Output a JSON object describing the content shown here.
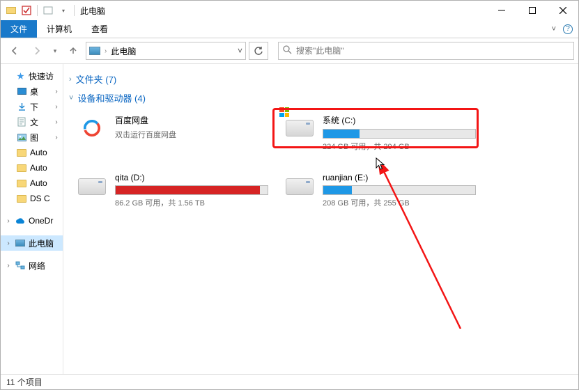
{
  "titlebar": {
    "title": "此电脑"
  },
  "ribbon": {
    "file": "文件",
    "computer": "计算机",
    "view": "查看"
  },
  "address": {
    "text": "此电脑"
  },
  "search": {
    "placeholder": "搜索\"此电脑\""
  },
  "sidebar": {
    "quick": "快速访",
    "items": [
      "桌",
      "下",
      "文",
      "图",
      "Auto",
      "Auto",
      "Auto",
      "DS C"
    ],
    "onedrive": "OneDr",
    "thispc": "此电脑",
    "network": "网络"
  },
  "sections": {
    "folders": {
      "label": "文件夹 (7)"
    },
    "devices": {
      "label": "设备和驱动器 (4)"
    }
  },
  "drives": [
    {
      "kind": "app",
      "name": "百度网盘",
      "sub": "双击运行百度网盘"
    },
    {
      "kind": "os",
      "name": "系统 (C:)",
      "sub": "224 GB 可用，共 294 GB",
      "fill_pct": 24,
      "fill_color": "#1e98e6"
    },
    {
      "kind": "drive",
      "name": "qita (D:)",
      "sub": "86.2 GB 可用，共 1.56 TB",
      "fill_pct": 95,
      "fill_color": "#d62424"
    },
    {
      "kind": "drive",
      "name": "ruanjian (E:)",
      "sub": "208 GB 可用，共 255 GB",
      "fill_pct": 19,
      "fill_color": "#1e98e6"
    }
  ],
  "status": {
    "text": "11 个项目"
  }
}
